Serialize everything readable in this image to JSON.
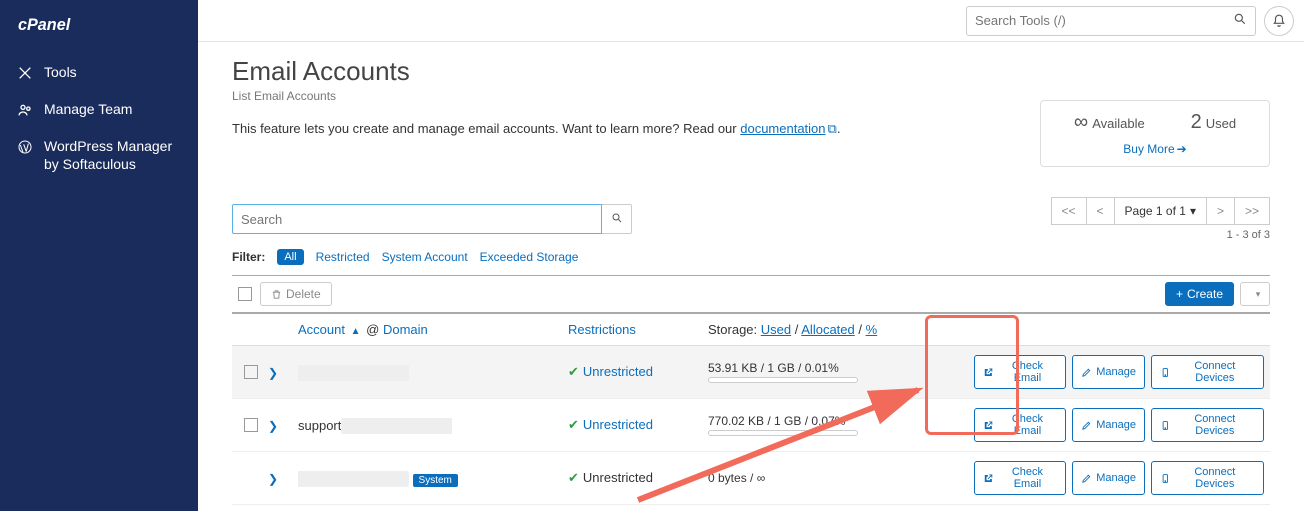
{
  "topbar": {
    "search_placeholder": "Search Tools (/)"
  },
  "sidebar": {
    "items": [
      {
        "label": "Tools"
      },
      {
        "label": "Manage Team"
      },
      {
        "label": "WordPress Manager by Softaculous"
      }
    ]
  },
  "page": {
    "title": "Email Accounts",
    "subtitle": "List Email Accounts",
    "intro_pre": "This feature lets you create and manage email accounts. Want to learn more? Read our ",
    "intro_link": "documentation",
    "intro_post": "."
  },
  "stats": {
    "available_icon": "∞",
    "available_label": "Available",
    "used_value": "2",
    "used_label": "Used",
    "buymore": "Buy More"
  },
  "search": {
    "placeholder": "Search"
  },
  "pager": {
    "first": "<<",
    "prev": "<",
    "mid": "Page 1 of 1",
    "next": ">",
    "last": ">>",
    "info": "1 - 3 of 3"
  },
  "filters": {
    "label": "Filter:",
    "all": "All",
    "restricted": "Restricted",
    "system": "System Account",
    "exceeded": "Exceeded Storage"
  },
  "actions": {
    "delete": "Delete",
    "create": "Create"
  },
  "thead": {
    "account": "Account",
    "domain": "Domain",
    "at": "@",
    "restrictions": "Restrictions",
    "storage": "Storage:",
    "used": "Used",
    "allocated": "Allocated",
    "percent": "%"
  },
  "btns": {
    "check": "Check Email",
    "manage": "Manage",
    "connect": "Connect Devices"
  },
  "rows": [
    {
      "account": "████████████",
      "blur": true,
      "restriction": "Unrestricted",
      "rest_blue": true,
      "storage": "53.91 KB / 1 GB / 0.01%",
      "meter": true,
      "chk": true,
      "alt": true
    },
    {
      "account": "support@███████",
      "blur_partial": true,
      "restriction": "Unrestricted",
      "rest_blue": true,
      "storage": "770.02 KB / 1 GB / 0.07%",
      "meter": true,
      "chk": true
    },
    {
      "account": "████",
      "blur": true,
      "system": true,
      "restriction": "Unrestricted",
      "rest_blue": false,
      "storage": "0 bytes / ∞",
      "meter": false,
      "chk": false
    }
  ],
  "system_label": "System"
}
